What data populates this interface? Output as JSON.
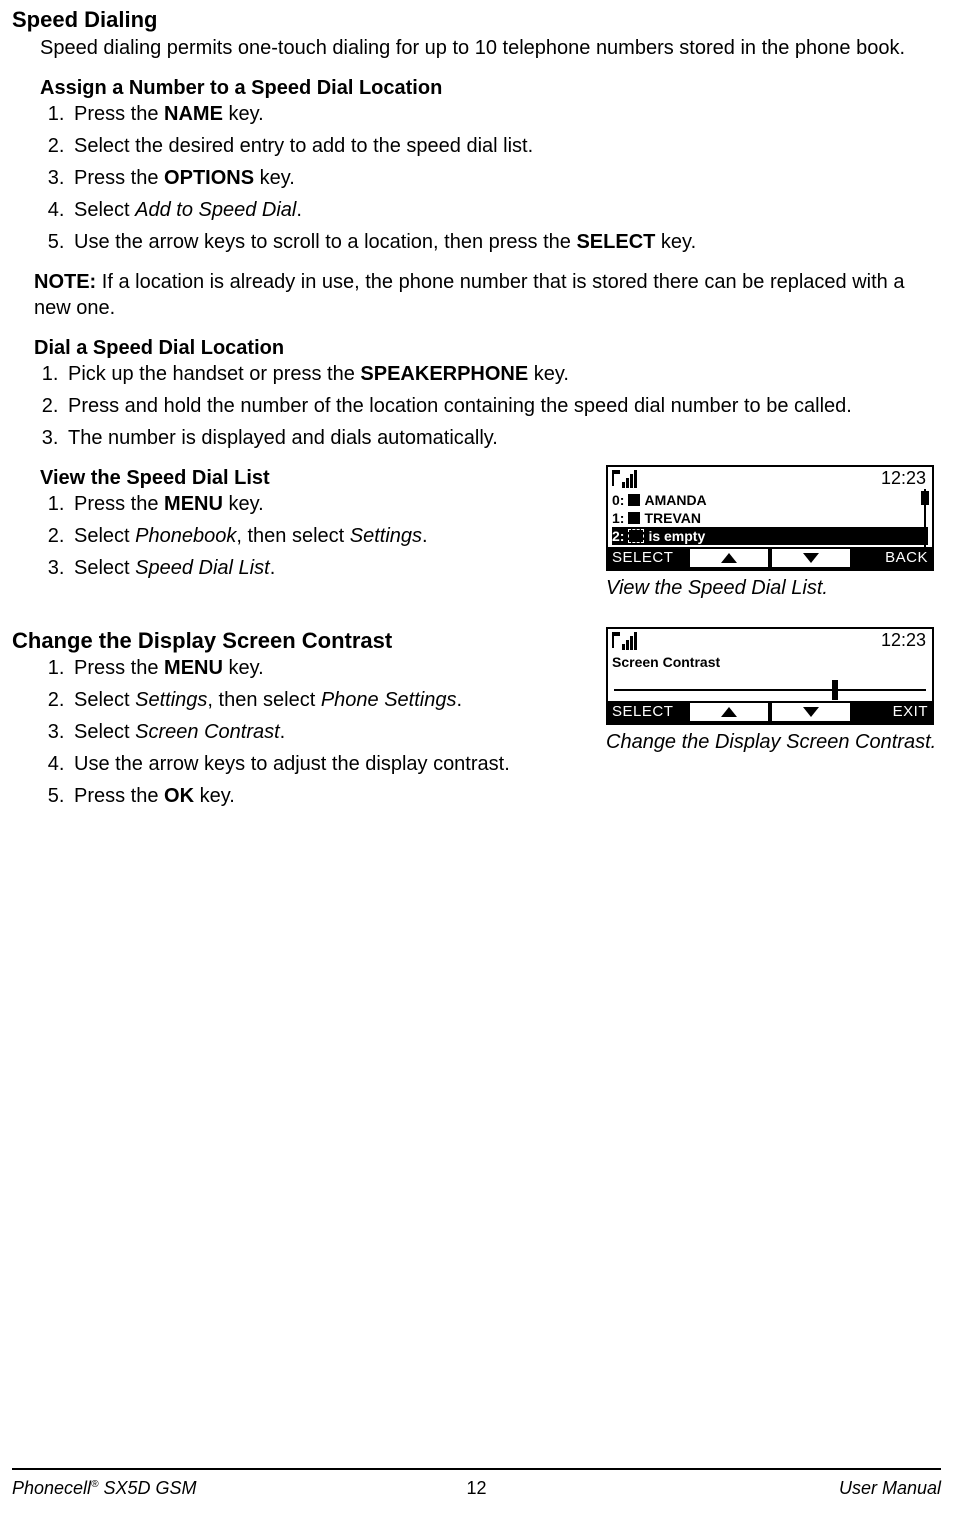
{
  "sections": {
    "speed_dialing": {
      "title": "Speed Dialing",
      "intro": "Speed dialing permits one-touch dialing for up to 10 telephone numbers stored in the phone book.",
      "assign": {
        "title": "Assign a Number to a Speed Dial Location",
        "steps": {
          "s1_a": "Press the ",
          "s1_b": "NAME",
          "s1_c": " key.",
          "s2": "Select the desired entry to add to the speed dial list.",
          "s3_a": "Press the ",
          "s3_b": "OPTIONS",
          "s3_c": " key.",
          "s4_a": "Select ",
          "s4_b": "Add to Speed Dial",
          "s4_c": ".",
          "s5_a": "Use the arrow keys to scroll to a location, then press the ",
          "s5_b": "SELECT",
          "s5_c": " key."
        }
      },
      "note_label": "NOTE:",
      "note_text": " If a location is already in use, the phone number that is stored there can be replaced with a new one.",
      "dial": {
        "title": "Dial a Speed Dial Location",
        "steps": {
          "s1_a": "Pick up the handset or press the ",
          "s1_b": "SPEAKERPHONE",
          "s1_c": " key.",
          "s2": "Press and hold the number of the location containing the speed dial number to be called.",
          "s3": "The number is displayed and dials automatically."
        }
      },
      "view": {
        "title": "View the Speed Dial List",
        "steps": {
          "s1_a": "Press the ",
          "s1_b": "MENU",
          "s1_c": " key.",
          "s2_a": "Select ",
          "s2_b": "Phonebook",
          "s2_c": ", then select ",
          "s2_d": "Settings",
          "s2_e": ".",
          "s3_a": "Select ",
          "s3_b": "Speed Dial List",
          "s3_c": "."
        }
      }
    },
    "contrast": {
      "title": "Change the Display Screen Contrast",
      "steps": {
        "s1_a": "Press the ",
        "s1_b": "MENU",
        "s1_c": " key.",
        "s2_a": "Select ",
        "s2_b": "Settings",
        "s2_c": ", then select ",
        "s2_d": "Phone Settings",
        "s2_e": ".",
        "s3_a": "Select ",
        "s3_b": "Screen Contrast",
        "s3_c": ".",
        "s4": "Use the arrow keys to adjust the display contrast.",
        "s5_a": "Press the ",
        "s5_b": "OK",
        "s5_c": " key."
      }
    }
  },
  "figures": {
    "speed_list": {
      "time": "12:23",
      "row0_num": "0:",
      "row0_name": "AMANDA",
      "row1_num": "1:",
      "row1_name": "TREVAN",
      "row2_num": "2:",
      "row2_text": "is empty",
      "soft_left": "SELECT",
      "soft_right": "BACK",
      "caption": "View the Speed Dial List."
    },
    "contrast": {
      "time": "12:23",
      "title": "Screen Contrast",
      "soft_left": "SELECT",
      "soft_right": "EXIT",
      "caption": "Change the Display Screen Contrast."
    }
  },
  "footer": {
    "left_a": "Phonecell",
    "left_b": " SX5D GSM",
    "center": "12",
    "right": "User Manual"
  }
}
